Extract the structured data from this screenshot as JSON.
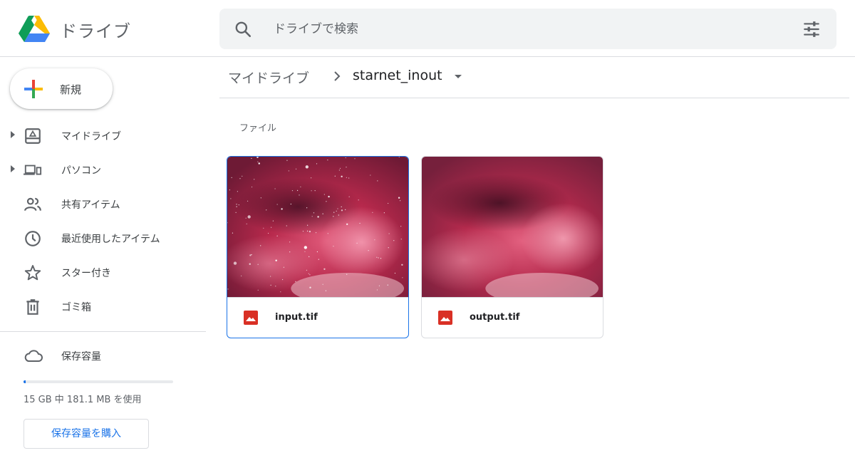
{
  "header": {
    "app_title": "ドライブ",
    "search_placeholder": "ドライブで検索"
  },
  "sidebar": {
    "new_label": "新規",
    "items": [
      {
        "label": "マイドライブ",
        "icon": "my-drive-icon",
        "expandable": true
      },
      {
        "label": "パソコン",
        "icon": "computers-icon",
        "expandable": true
      },
      {
        "label": "共有アイテム",
        "icon": "shared-people-icon",
        "expandable": false
      },
      {
        "label": "最近使用したアイテム",
        "icon": "clock-icon",
        "expandable": false
      },
      {
        "label": "スター付き",
        "icon": "star-icon",
        "expandable": false
      },
      {
        "label": "ゴミ箱",
        "icon": "trash-icon",
        "expandable": false
      }
    ],
    "storage": {
      "label": "保存容量",
      "usage_text": "15 GB 中 181.1 MB を使用",
      "used_fraction": 0.012,
      "buy_label": "保存容量を購入"
    }
  },
  "main": {
    "breadcrumb": {
      "root": "マイドライブ",
      "current": "starnet_inout"
    },
    "section_label": "ファイル",
    "files": [
      {
        "name": "input.tif",
        "selected": true,
        "icon": "image-file-icon"
      },
      {
        "name": "output.tif",
        "selected": false,
        "icon": "image-file-icon"
      }
    ]
  },
  "colors": {
    "accent": "#1a73e8",
    "image_icon": "#d93025",
    "nebula_base": "#b2294a"
  }
}
